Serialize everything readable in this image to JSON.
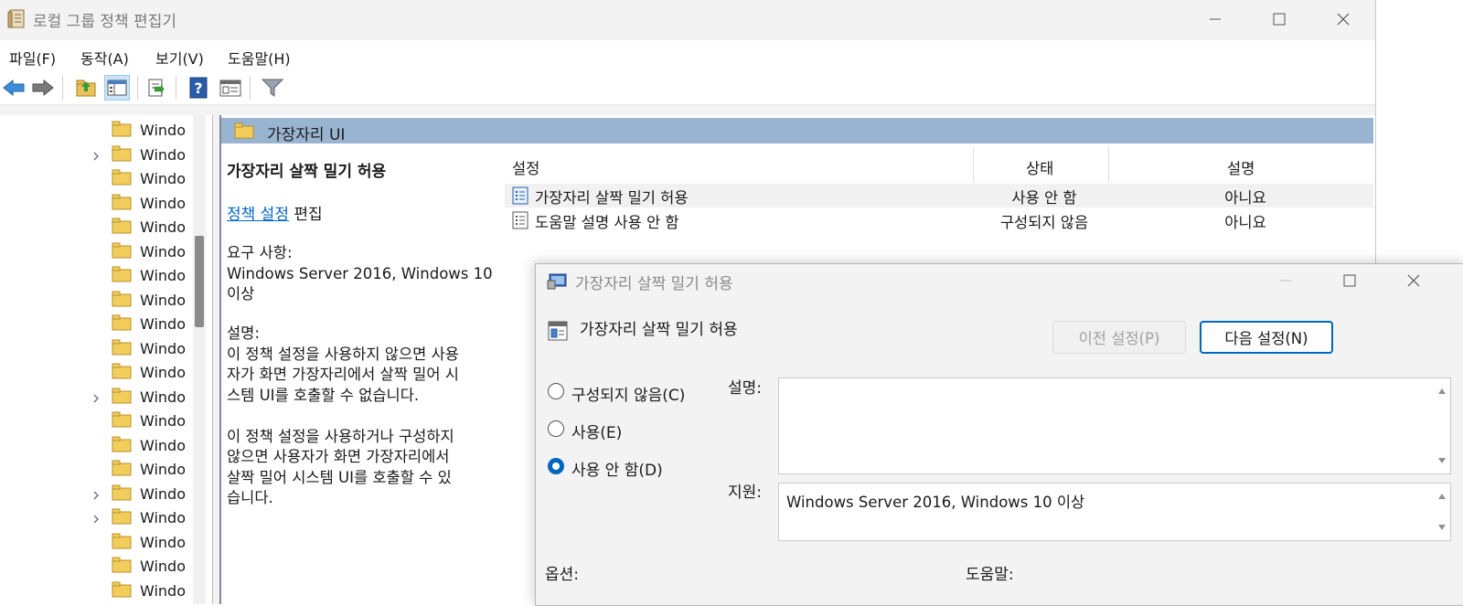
{
  "window": {
    "title": "로컬 그룹 정책 편집기"
  },
  "menu": [
    "파일(F)",
    "동작(A)",
    "보기(V)",
    "도움말(H)"
  ],
  "toolbar": {
    "icons": [
      "back-arrow-icon",
      "forward-arrow-icon",
      "up-folder-icon",
      "show-hide-tree-icon",
      "export-list-icon",
      "help-icon",
      "properties-icon",
      "filter-icon"
    ]
  },
  "tree": {
    "items": [
      {
        "label": "Windo",
        "expandable": false
      },
      {
        "label": "Windo",
        "expandable": true
      },
      {
        "label": "Windo",
        "expandable": false
      },
      {
        "label": "Windo",
        "expandable": false
      },
      {
        "label": "Windo",
        "expandable": false
      },
      {
        "label": "Windo",
        "expandable": false
      },
      {
        "label": "Windo",
        "expandable": false
      },
      {
        "label": "Windo",
        "expandable": false
      },
      {
        "label": "Windo",
        "expandable": false
      },
      {
        "label": "Windo",
        "expandable": false
      },
      {
        "label": "Windo",
        "expandable": false
      },
      {
        "label": "Windo",
        "expandable": true
      },
      {
        "label": "Windo",
        "expandable": false
      },
      {
        "label": "Windo",
        "expandable": false
      },
      {
        "label": "Windo",
        "expandable": false
      },
      {
        "label": "Windo",
        "expandable": true
      },
      {
        "label": "Windo",
        "expandable": true
      },
      {
        "label": "Windo",
        "expandable": false
      },
      {
        "label": "Windo",
        "expandable": false
      },
      {
        "label": "Windo",
        "expandable": false
      }
    ]
  },
  "content": {
    "header": "가장자리 UI",
    "description": {
      "title": "가장자리 살짝 밀기 허용",
      "link": "정책 설정",
      "link_suffix": "편집",
      "requirements_label": "요구 사항:",
      "requirements_lines": [
        "Windows Server 2016, Windows 10",
        "이상"
      ],
      "desc_label": "설명:",
      "desc_para1": [
        "이 정책 설정을 사용하지 않으면 사용",
        "자가 화면 가장자리에서 살짝 밀어 시",
        "스템 UI를 호출할 수 없습니다."
      ],
      "desc_para2": [
        "이 정책 설정을 사용하거나 구성하지",
        "않으면 사용자가 화면 가장자리에서",
        "살짝 밀어 시스템 UI를 호출할 수 있",
        "습니다."
      ]
    },
    "columns": [
      "설정",
      "상태",
      "설명"
    ],
    "rows": [
      {
        "name": "가장자리 살짝 밀기 허용",
        "state": "사용 안 함",
        "comment": "아니요"
      },
      {
        "name": "도움말 설명 사용 안 함",
        "state": "구성되지 않음",
        "comment": "아니요"
      }
    ]
  },
  "dialog": {
    "title": "가장자리 살짝 밀기 허용",
    "policy_name": "가장자리 살짝 밀기 허용",
    "prev_button": "이전 설정(P)",
    "next_button": "다음 설정(N)",
    "options": [
      {
        "label": "구성되지 않음(C)",
        "selected": false
      },
      {
        "label": "사용(E)",
        "selected": false
      },
      {
        "label": "사용 안 함(D)",
        "selected": true
      }
    ],
    "comment_label": "설명:",
    "comment_value": "",
    "supported_label": "지원:",
    "supported_value": "Windows Server 2016, Windows 10 이상",
    "options_label": "옵션:",
    "help_label": "도움말:"
  },
  "colors": {
    "accent": "#0067c0",
    "header_band": "#99b4d1",
    "link": "#0066cc"
  }
}
